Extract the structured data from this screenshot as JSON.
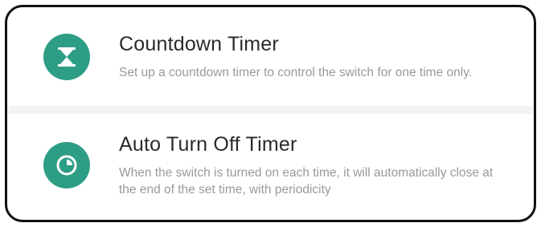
{
  "colors": {
    "accent": "#2e9d86",
    "title": "#2b2b2b",
    "description": "#9a9a9a",
    "divider": "#f3f3f3"
  },
  "options": [
    {
      "icon": "hourglass-icon",
      "title": "Countdown Timer",
      "description": "Set up a countdown timer to control the switch for one time only."
    },
    {
      "icon": "clock-icon",
      "title": "Auto Turn Off Timer",
      "description": "When the switch is turned on each time, it will automatically close at the end of the set time, with periodicity"
    }
  ]
}
